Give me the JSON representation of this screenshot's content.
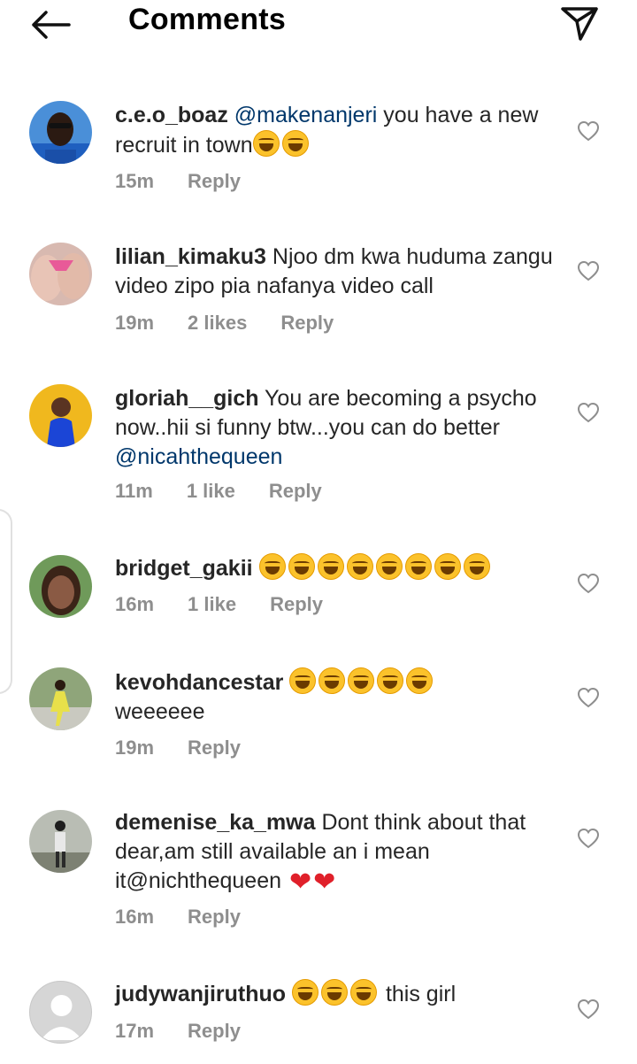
{
  "header": {
    "title": "Comments"
  },
  "colors": {
    "mention": "#00376b",
    "meta": "#8e8e8e",
    "emoji": "#fbc22b",
    "heart_emoji": "#e0202a"
  },
  "icons": {
    "back": "arrow-left-icon",
    "send": "paper-plane-icon",
    "like": "heart-outline-icon",
    "emoji": "face-with-tears-of-joy-icon"
  },
  "comments": [
    {
      "username": "c.e.o_boaz",
      "mention": "@makenanjeri",
      "text": " you have a new recruit in town",
      "time": "15m",
      "likes": "",
      "reply": "Reply",
      "laugh_emojis": 2
    },
    {
      "username": "lilian_kimaku3",
      "text": " Njoo dm kwa huduma zangu video zipo pia nafanya video call",
      "time": "19m",
      "likes": "2 likes",
      "reply": "Reply"
    },
    {
      "username": "gloriah__gich",
      "text": " You are becoming a psycho now..hii si funny btw...you can do better ",
      "mention": "@nicahthequeen",
      "time": "11m",
      "likes": "1 like",
      "reply": "Reply"
    },
    {
      "username": "bridget_gakii",
      "text": "",
      "time": "16m",
      "likes": "1 like",
      "reply": "Reply",
      "laugh_emojis": 8
    },
    {
      "username": "kevohdancestar",
      "text": "weeeeee",
      "time": "19m",
      "likes": "",
      "reply": "Reply",
      "laugh_emojis": 5
    },
    {
      "username": "demenise_ka_mwa",
      "text": " Dont think about that dear,am still available an i mean it@nichthequeen",
      "time": "16m",
      "likes": "",
      "reply": "Reply",
      "heart_emojis": 2
    },
    {
      "username": "judywanjiruthuo",
      "text": " this girl",
      "time": "17m",
      "likes": "",
      "reply": "Reply",
      "laugh_emojis": 3
    }
  ]
}
